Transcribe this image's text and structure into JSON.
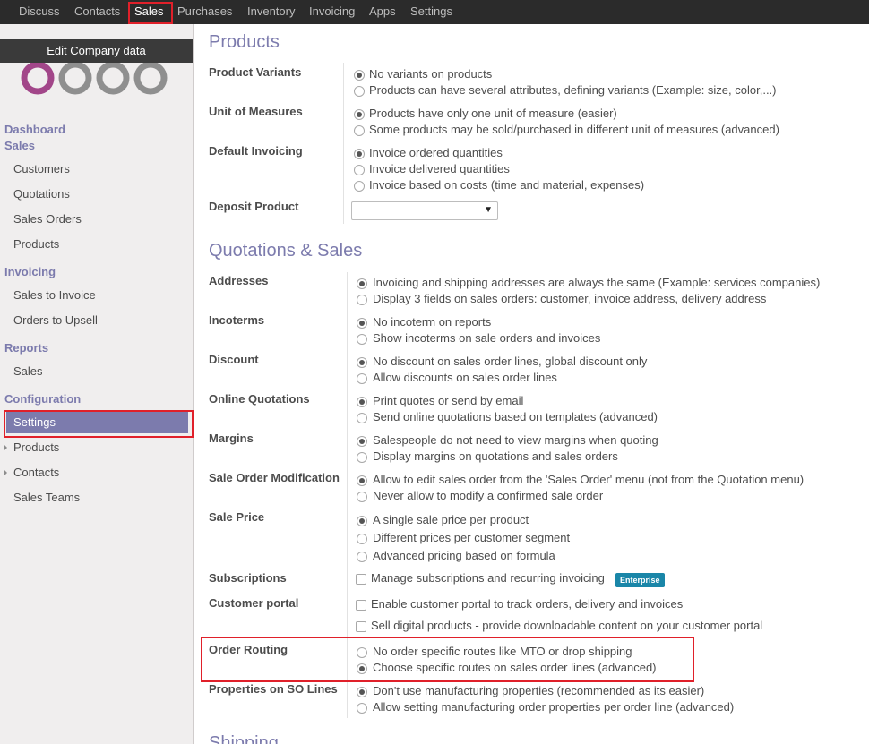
{
  "topnav": [
    "Discuss",
    "Contacts",
    "Sales",
    "Purchases",
    "Inventory",
    "Invoicing",
    "Apps",
    "Settings"
  ],
  "sidebar": {
    "edit_company": "Edit Company data",
    "logo_text": "odoo",
    "dashboard": "Dashboard",
    "sales_head": "Sales",
    "sales_items": [
      "Customers",
      "Quotations",
      "Sales Orders",
      "Products"
    ],
    "invoicing_head": "Invoicing",
    "invoicing_items": [
      "Sales to Invoice",
      "Orders to Upsell"
    ],
    "reports_head": "Reports",
    "reports_items": [
      "Sales"
    ],
    "config_head": "Configuration",
    "config_items": [
      "Settings",
      "Products",
      "Contacts",
      "Sales Teams"
    ]
  },
  "sections": {
    "products": "Products",
    "quotations_sales": "Quotations & Sales",
    "shipping": "Shipping"
  },
  "rows": {
    "product_variants": {
      "label": "Product Variants",
      "options": [
        "No variants on products",
        "Products can have several attributes, defining variants (Example: size, color,...)"
      ]
    },
    "unit_of_measures": {
      "label": "Unit of Measures",
      "options": [
        "Products have only one unit of measure (easier)",
        "Some products may be sold/purchased in different unit of measures (advanced)"
      ]
    },
    "default_invoicing": {
      "label": "Default Invoicing",
      "options": [
        "Invoice ordered quantities",
        "Invoice delivered quantities",
        "Invoice based on costs (time and material, expenses)"
      ]
    },
    "deposit_product": {
      "label": "Deposit Product",
      "value": ""
    },
    "addresses": {
      "label": "Addresses",
      "options": [
        "Invoicing and shipping addresses are always the same (Example: services companies)",
        "Display 3 fields on sales orders: customer, invoice address, delivery address"
      ]
    },
    "incoterms": {
      "label": "Incoterms",
      "options": [
        "No incoterm on reports",
        "Show incoterms on sale orders and invoices"
      ]
    },
    "discount": {
      "label": "Discount",
      "options": [
        "No discount on sales order lines, global discount only",
        "Allow discounts on sales order lines"
      ]
    },
    "online_quotations": {
      "label": "Online Quotations",
      "options": [
        "Print quotes or send by email",
        "Send online quotations based on templates (advanced)"
      ]
    },
    "margins": {
      "label": "Margins",
      "options": [
        "Salespeople do not need to view margins when quoting",
        "Display margins on quotations and sales orders"
      ]
    },
    "sale_order_modification": {
      "label": "Sale Order Modification",
      "options": [
        "Allow to edit sales order from the 'Sales Order' menu (not from the Quotation menu)",
        "Never allow to modify a confirmed sale order"
      ]
    },
    "sale_price": {
      "label": "Sale Price",
      "options": [
        "A single sale price per product",
        "Different prices per customer segment",
        "Advanced pricing based on formula"
      ]
    },
    "subscriptions": {
      "label": "Subscriptions",
      "option": "Manage subscriptions and recurring invoicing",
      "badge": "Enterprise"
    },
    "customer_portal": {
      "label": "Customer portal",
      "options": [
        "Enable customer portal to track orders, delivery and invoices",
        "Sell digital products - provide downloadable content on your customer portal"
      ]
    },
    "order_routing": {
      "label": "Order Routing",
      "options": [
        "No order specific routes like MTO or drop shipping",
        "Choose specific routes on sales order lines (advanced)"
      ]
    },
    "properties_so_lines": {
      "label": "Properties on SO Lines",
      "options": [
        "Don't use manufacturing properties (recommended as its easier)",
        "Allow setting manufacturing order properties per order line (advanced)"
      ]
    }
  },
  "colors": {
    "accent": "#7c7bad",
    "highlight": "#e0202a",
    "badge": "#1a86a8"
  }
}
